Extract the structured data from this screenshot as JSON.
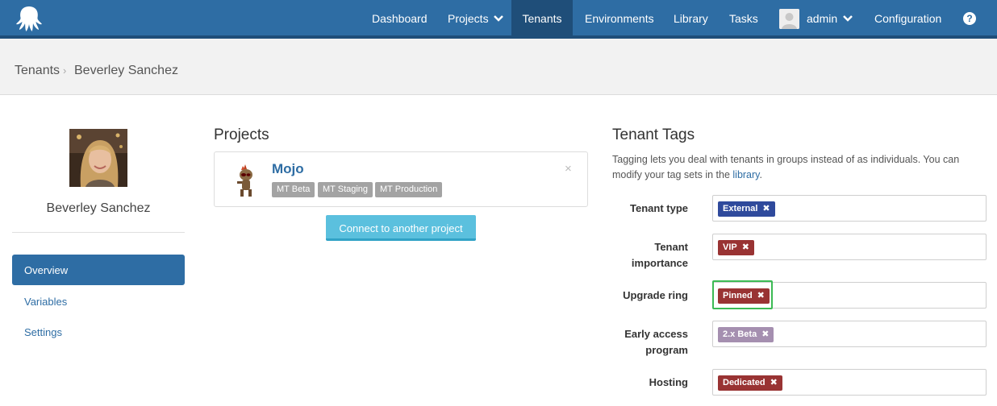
{
  "nav": {
    "items": [
      {
        "label": "Dashboard"
      },
      {
        "label": "Projects"
      },
      {
        "label": "Tenants"
      },
      {
        "label": "Environments"
      },
      {
        "label": "Library"
      },
      {
        "label": "Tasks"
      },
      {
        "label": "admin"
      },
      {
        "label": "Configuration"
      }
    ],
    "help_label": "?"
  },
  "breadcrumb": {
    "root": "Tenants",
    "separator": "›",
    "current": "Beverley Sanchez"
  },
  "profile": {
    "name": "Beverley Sanchez"
  },
  "sidebar": {
    "items": [
      {
        "label": "Overview"
      },
      {
        "label": "Variables"
      },
      {
        "label": "Settings"
      }
    ]
  },
  "projects": {
    "heading": "Projects",
    "card": {
      "name": "Mojo",
      "close": "×",
      "environments": [
        "MT Beta",
        "MT Staging",
        "MT Production"
      ]
    },
    "connect_label": "Connect to another project"
  },
  "tags": {
    "heading": "Tenant Tags",
    "desc_prefix": "Tagging lets you deal with tenants in groups instead of as individuals. You can modify your tag sets in the ",
    "desc_link": "library",
    "desc_suffix": ".",
    "rows": [
      {
        "label": "Tenant type",
        "chip": "External",
        "color": "#2f4a9c"
      },
      {
        "label": "Tenant importance",
        "chip": "VIP",
        "color": "#993333"
      },
      {
        "label": "Upgrade ring",
        "chip": "Pinned",
        "color": "#993333"
      },
      {
        "label": "Early access program",
        "chip": "2.x Beta",
        "color": "#a58fb0"
      },
      {
        "label": "Hosting",
        "chip": "Dedicated",
        "color": "#993333"
      }
    ],
    "remove_glyph": "✖"
  },
  "colors": {
    "nav_bg": "#2e6da4",
    "nav_active": "#1f4e79",
    "accent_button": "#5bc0de",
    "highlight": "#3cba54"
  }
}
